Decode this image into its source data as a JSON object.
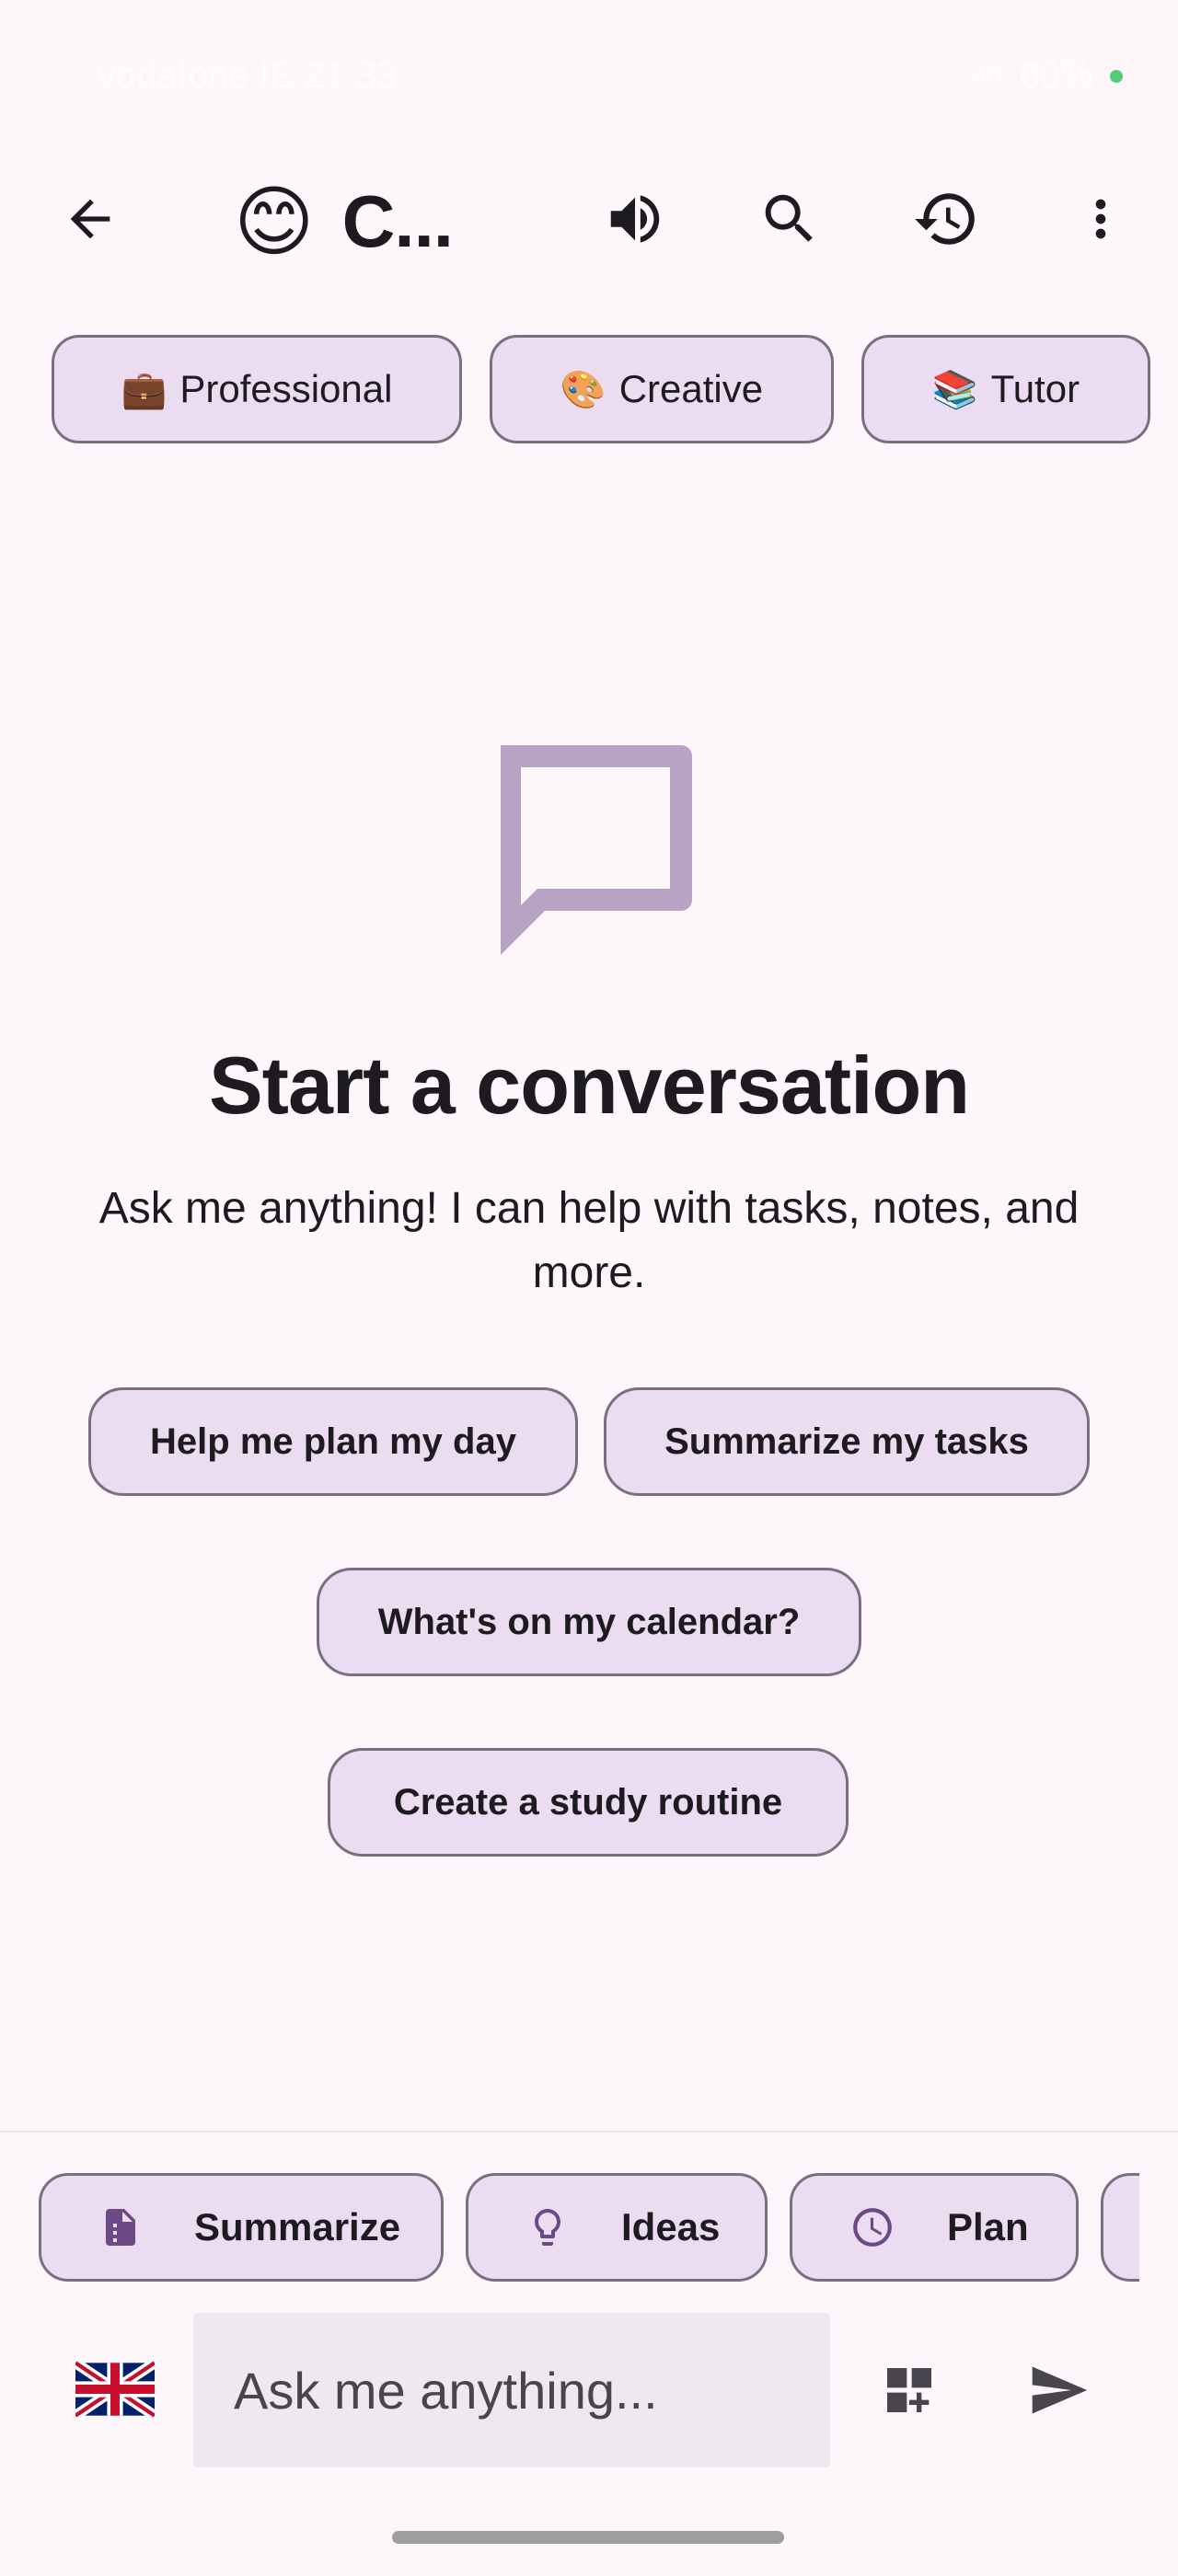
{
  "status_bar": {
    "carrier_time": "vodafone IE 21:33",
    "network": "4G",
    "battery": "60%"
  },
  "toolbar": {
    "back_icon": "arrow-back-icon",
    "avatar_emoji": "😊",
    "title": "C...",
    "speaker_icon": "volume-icon",
    "search_icon": "search-icon",
    "history_icon": "history-icon",
    "more_icon": "more-vert-icon"
  },
  "personas": [
    {
      "emoji": "💼",
      "label": "Professional"
    },
    {
      "emoji": "🎨",
      "label": "Creative"
    },
    {
      "emoji": "📚",
      "label": "Tutor"
    }
  ],
  "empty_state": {
    "icon": "chat-bubble-icon",
    "title": "Start a conversation",
    "subtitle": "Ask me anything! I can help with tasks, notes, and more."
  },
  "suggestions": [
    "Help me plan my day",
    "Summarize my tasks",
    "What's on my calendar?",
    "Create a study routine"
  ],
  "quick_actions": [
    {
      "icon": "document-icon",
      "label": "Summarize"
    },
    {
      "icon": "lightbulb-icon",
      "label": "Ideas"
    },
    {
      "icon": "clock-icon",
      "label": "Plan"
    }
  ],
  "input": {
    "language_icon": "uk-flag-icon",
    "placeholder": "Ask me anything...",
    "add_widget_icon": "grid-add-icon",
    "send_icon": "send-icon"
  },
  "colors": {
    "background": "#fdf7fb",
    "chip_fill": "#ecdcf2",
    "chip_border": "#7a6f80",
    "accent": "#6b4a86",
    "icon_muted": "#b8a3c4"
  }
}
